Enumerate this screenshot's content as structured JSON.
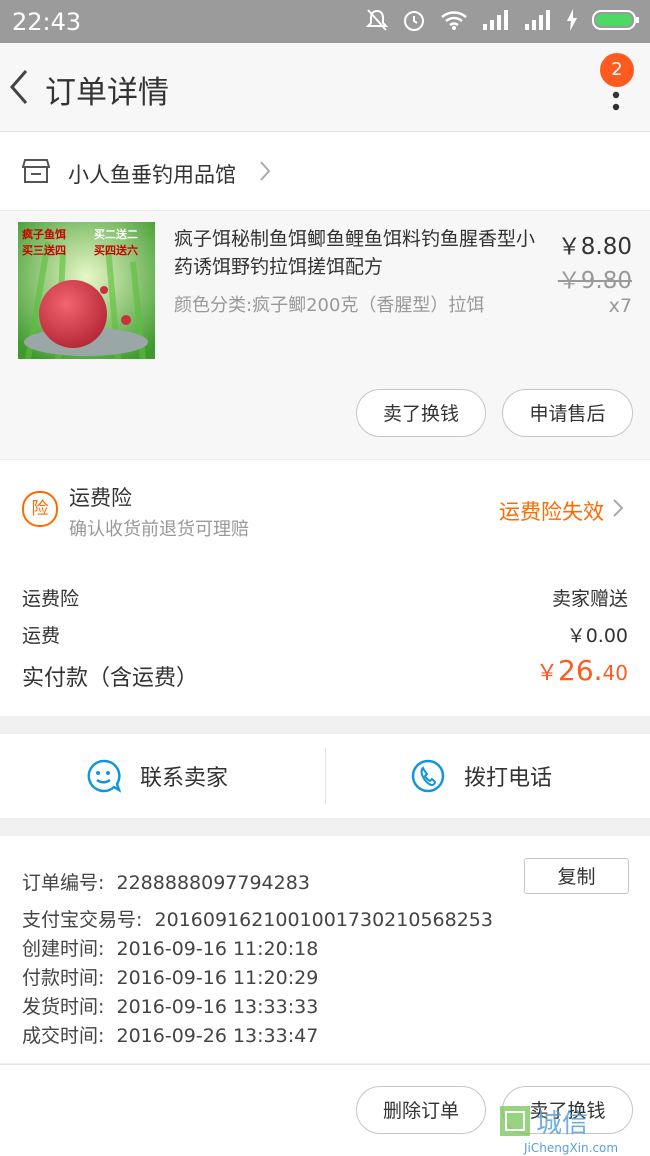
{
  "status_bar": {
    "time": "22:43"
  },
  "nav": {
    "title": "订单详情",
    "badge": "2"
  },
  "shop": {
    "name": "小人鱼垂钓用品馆"
  },
  "product": {
    "thumb_text": [
      "疯子鱼饵",
      "买二送二",
      "买三送四",
      "买四送六"
    ],
    "title": "疯子饵秘制鱼饵鲫鱼鲤鱼饵料钓鱼腥香型小药诱饵野钓拉饵搓饵配方",
    "spec": "颜色分类:疯子鲫200克（香腥型）拉饵",
    "price": "￥8.80",
    "original_price": "￥9.80",
    "quantity": "x7",
    "btn_sell": "卖了换钱",
    "btn_aftersale": "申请售后"
  },
  "insurance": {
    "icon_text": "险",
    "title": "运费险",
    "subtitle": "确认收货前退货可理赔",
    "status": "运费险失效"
  },
  "fees": {
    "insurance_label": "运费险",
    "insurance_value": "卖家赠送",
    "shipping_label": "运费",
    "shipping_value": "￥0.00",
    "total_label": "实付款（含运费）",
    "total_currency": "￥",
    "total_int": "26.",
    "total_dec": "40"
  },
  "contact": {
    "seller": "联系卖家",
    "phone": "拨打电话"
  },
  "order_info": {
    "order_no_label": "订单编号:",
    "order_no": "2288888097794283",
    "copy_label": "复制",
    "alipay_label": "支付宝交易号:",
    "alipay_no": "2016091621001001730210568253",
    "created_label": "创建时间:",
    "created": "2016-09-16 11:20:18",
    "paid_label": "付款时间:",
    "paid": "2016-09-16 11:20:29",
    "shipped_label": "发货时间:",
    "shipped": "2016-09-16 13:33:33",
    "completed_label": "成交时间:",
    "completed": "2016-09-26 13:33:47"
  },
  "actions": {
    "delete": "删除订单",
    "sell": "卖了换钱"
  },
  "watermark": {
    "site": "JiChengXin.com",
    "logo_text": "城信"
  },
  "colors": {
    "accent": "#ff6a00",
    "badge": "#ff5a1f",
    "link_icon": "#1296db"
  }
}
